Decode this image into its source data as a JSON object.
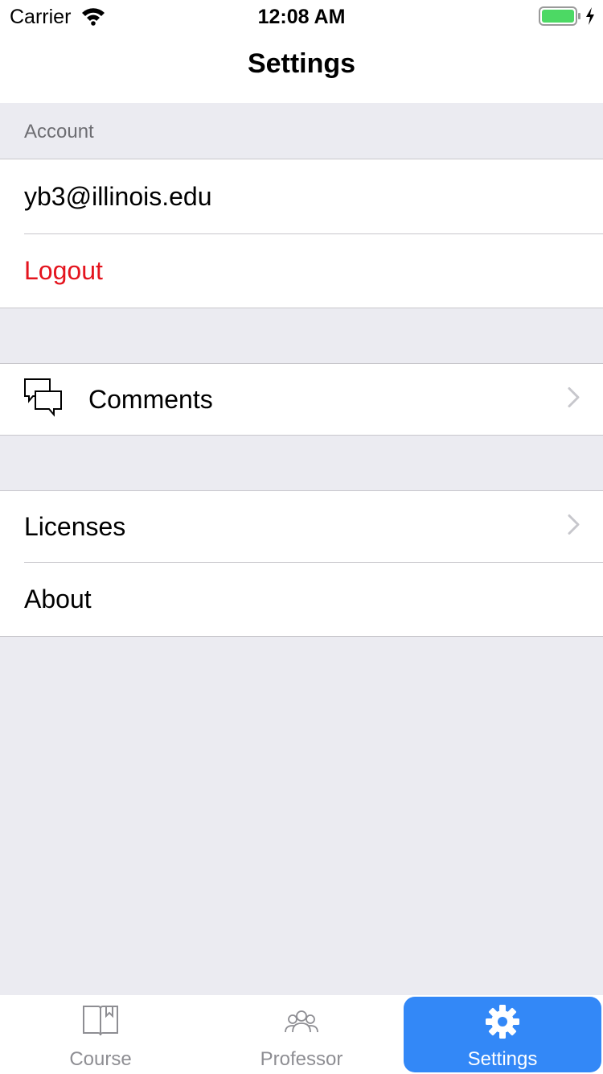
{
  "status_bar": {
    "carrier": "Carrier",
    "time": "12:08 AM"
  },
  "nav": {
    "title": "Settings"
  },
  "account_section": {
    "header": "Account",
    "email": "yb3@illinois.edu",
    "logout_label": "Logout"
  },
  "comments_section": {
    "label": "Comments",
    "icon": "comments-icon"
  },
  "info_section": {
    "licenses_label": "Licenses",
    "about_label": "About"
  },
  "tab_bar": {
    "items": [
      {
        "label": "Course",
        "icon": "book-icon"
      },
      {
        "label": "Professor",
        "icon": "people-icon"
      },
      {
        "label": "Settings",
        "icon": "gear-icon"
      }
    ],
    "active_index": 2
  },
  "colors": {
    "accent": "#3388f7",
    "destructive": "#e4141e",
    "grouped_background": "#ebebf1",
    "battery": "#4cd964"
  }
}
